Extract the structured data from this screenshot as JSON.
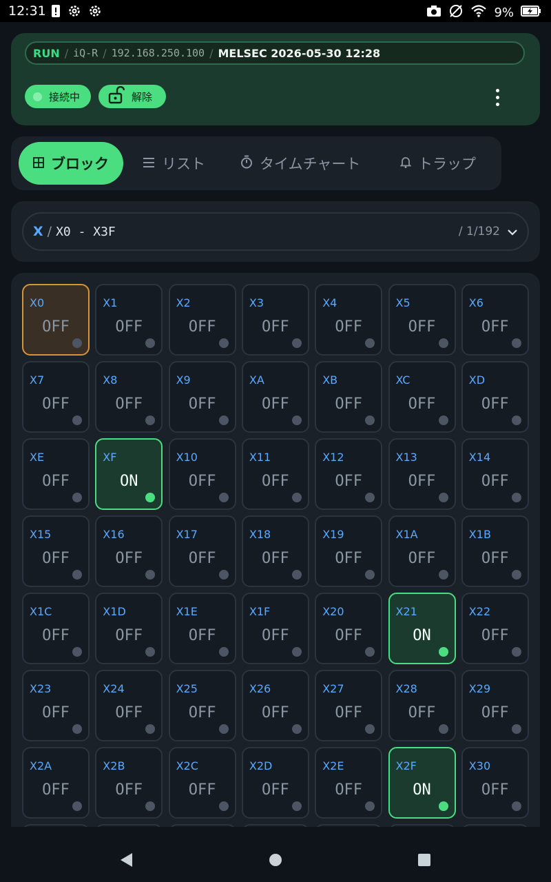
{
  "status_bar": {
    "time": "12:31",
    "battery": "9%"
  },
  "header": {
    "run_state": "RUN",
    "cpu": "iQ-R",
    "ip": "192.168.250.100",
    "plc_info": "MELSEC 2026-05-30 12:28",
    "connection_label": "接続中",
    "unlock_label": "解除"
  },
  "tabs": [
    {
      "label": "ブロック",
      "icon": "grid-icon"
    },
    {
      "label": "リスト",
      "icon": "list-icon"
    },
    {
      "label": "タイムチャート",
      "icon": "stopwatch-icon"
    },
    {
      "label": "トラップ",
      "icon": "bell-icon"
    }
  ],
  "selector": {
    "device": "X",
    "range": "X0 - X3F",
    "page": "/ 1/192"
  },
  "cells": [
    {
      "label": "X0",
      "state": "OFF"
    },
    {
      "label": "X1",
      "state": "OFF"
    },
    {
      "label": "X2",
      "state": "OFF"
    },
    {
      "label": "X3",
      "state": "OFF"
    },
    {
      "label": "X4",
      "state": "OFF"
    },
    {
      "label": "X5",
      "state": "OFF"
    },
    {
      "label": "X6",
      "state": "OFF"
    },
    {
      "label": "X7",
      "state": "OFF"
    },
    {
      "label": "X8",
      "state": "OFF"
    },
    {
      "label": "X9",
      "state": "OFF"
    },
    {
      "label": "XA",
      "state": "OFF"
    },
    {
      "label": "XB",
      "state": "OFF"
    },
    {
      "label": "XC",
      "state": "OFF"
    },
    {
      "label": "XD",
      "state": "OFF"
    },
    {
      "label": "XE",
      "state": "OFF"
    },
    {
      "label": "XF",
      "state": "ON"
    },
    {
      "label": "X10",
      "state": "OFF"
    },
    {
      "label": "X11",
      "state": "OFF"
    },
    {
      "label": "X12",
      "state": "OFF"
    },
    {
      "label": "X13",
      "state": "OFF"
    },
    {
      "label": "X14",
      "state": "OFF"
    },
    {
      "label": "X15",
      "state": "OFF"
    },
    {
      "label": "X16",
      "state": "OFF"
    },
    {
      "label": "X17",
      "state": "OFF"
    },
    {
      "label": "X18",
      "state": "OFF"
    },
    {
      "label": "X19",
      "state": "OFF"
    },
    {
      "label": "X1A",
      "state": "OFF"
    },
    {
      "label": "X1B",
      "state": "OFF"
    },
    {
      "label": "X1C",
      "state": "OFF"
    },
    {
      "label": "X1D",
      "state": "OFF"
    },
    {
      "label": "X1E",
      "state": "OFF"
    },
    {
      "label": "X1F",
      "state": "OFF"
    },
    {
      "label": "X20",
      "state": "OFF"
    },
    {
      "label": "X21",
      "state": "ON"
    },
    {
      "label": "X22",
      "state": "OFF"
    },
    {
      "label": "X23",
      "state": "OFF"
    },
    {
      "label": "X24",
      "state": "OFF"
    },
    {
      "label": "X25",
      "state": "OFF"
    },
    {
      "label": "X26",
      "state": "OFF"
    },
    {
      "label": "X27",
      "state": "OFF"
    },
    {
      "label": "X28",
      "state": "OFF"
    },
    {
      "label": "X29",
      "state": "OFF"
    },
    {
      "label": "X2A",
      "state": "OFF"
    },
    {
      "label": "X2B",
      "state": "OFF"
    },
    {
      "label": "X2C",
      "state": "OFF"
    },
    {
      "label": "X2D",
      "state": "OFF"
    },
    {
      "label": "X2E",
      "state": "OFF"
    },
    {
      "label": "X2F",
      "state": "ON"
    },
    {
      "label": "X30",
      "state": "OFF"
    }
  ],
  "selected_cell": "X0",
  "colors": {
    "accent": "#4ade80",
    "device_label": "#5aa9ff",
    "selected_border": "#d9943a",
    "header_bg": "#1b3b2f",
    "page_bg": "#0f141a"
  }
}
